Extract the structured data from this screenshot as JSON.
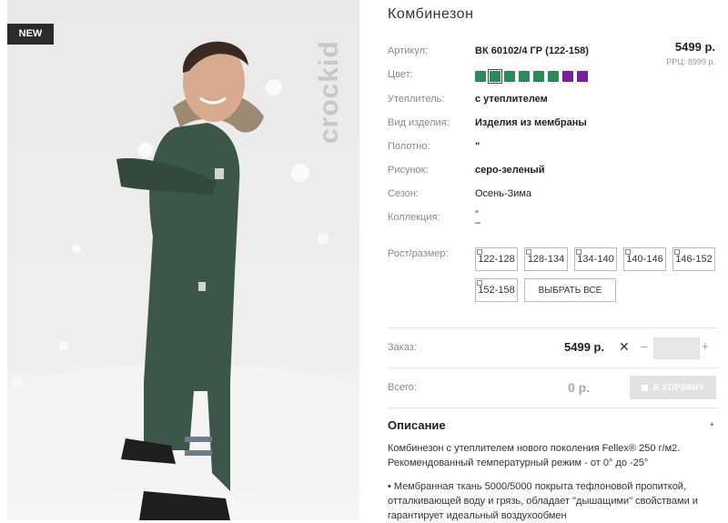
{
  "badge": "NEW",
  "brand": "crockid",
  "product": {
    "title": "Комбинезон"
  },
  "specs": [
    {
      "label": "Артикул:",
      "value": "ВК 60102/4 ГР (122-158)"
    },
    {
      "label": "Цвет:",
      "value": ""
    },
    {
      "label": "Утеплитель:",
      "value": "с утеплителем"
    },
    {
      "label": "Вид изделия:",
      "value": "Изделия из мембраны"
    },
    {
      "label": "Полотно:",
      "value": "\""
    },
    {
      "label": "Рисунок:",
      "value": "серо-зеленый"
    },
    {
      "label": "Сезон:",
      "value": "Осень-Зима"
    },
    {
      "label": "Коллекция:",
      "value": "\""
    }
  ],
  "collection_second_line": "–",
  "price": {
    "main": "5499 р.",
    "rrp": "РРЦ: 8999 р."
  },
  "colors": [
    "#2e8b57",
    "#2e8b57",
    "#2e8b57",
    "#2e8b57",
    "#2e8b57",
    "#2e8b57",
    "#7b1fa2",
    "#7b1fa2"
  ],
  "sizes": {
    "label": "Рост/размер:",
    "options": [
      "122-128",
      "128-134",
      "134-140",
      "140-146",
      "146-152",
      "152-158"
    ],
    "select_all": "ВЫБРАТЬ ВСЕ"
  },
  "order": {
    "label": "Заказ:",
    "price": "5499 р.",
    "times": "✕",
    "minus": "–",
    "plus": "+"
  },
  "total": {
    "label": "Всего:",
    "value": "0 р.",
    "cart": "В КОРЗИНУ"
  },
  "description": {
    "title": "Описание",
    "collapse": "▲",
    "p1_line1": "Комбинезон с утеплителем нового поколения Fellex® 250 г/м2.",
    "p1_line2": "Рекомендованный температурный режим - от 0° до -25°",
    "p2_line1": "• Мембранная ткань 5000/5000 покрыта тефлоновой пропиткой,",
    "p2_line2": "отталкивающей воду и грязь, обладает \"дышащими\" свойствами и",
    "p2_line3": "гарантирует идеальный воздухообмен"
  }
}
